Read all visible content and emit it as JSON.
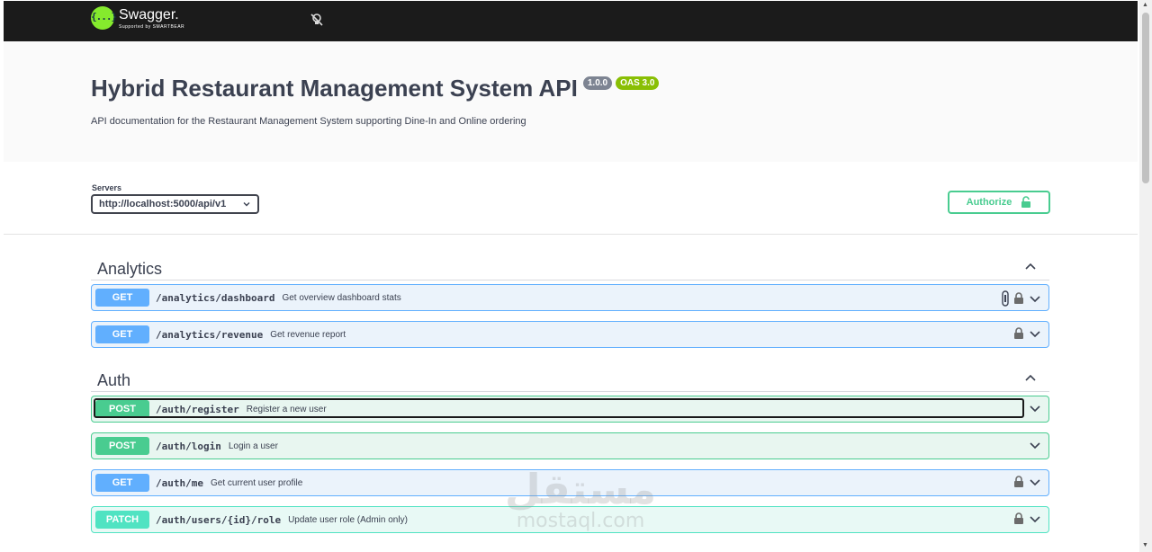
{
  "topbar": {
    "logo_name": "Swagger.",
    "logo_sub": "Supported by SMARTBEAR",
    "logo_mark": "{...}"
  },
  "info": {
    "title": "Hybrid Restaurant Management System API",
    "version_badge": "1.0.0",
    "oas_badge": "OAS 3.0",
    "description": "API documentation for the Restaurant Management System supporting Dine-In and Online ordering"
  },
  "servers": {
    "label": "Servers",
    "selected": "http://localhost:5000/api/v1"
  },
  "authorize": {
    "label": "Authorize"
  },
  "tags": [
    {
      "name": "Analytics",
      "operations": [
        {
          "method": "GET",
          "path": "/analytics/dashboard",
          "summary": "Get overview dashboard stats",
          "locked": true
        },
        {
          "method": "GET",
          "path": "/analytics/revenue",
          "summary": "Get revenue report",
          "locked": true
        }
      ]
    },
    {
      "name": "Auth",
      "operations": [
        {
          "method": "POST",
          "path": "/auth/register",
          "summary": "Register a new user",
          "locked": false
        },
        {
          "method": "POST",
          "path": "/auth/login",
          "summary": "Login a user",
          "locked": false
        },
        {
          "method": "GET",
          "path": "/auth/me",
          "summary": "Get current user profile",
          "locked": true
        },
        {
          "method": "PATCH",
          "path": "/auth/users/{id}/role",
          "summary": "Update user role (Admin only)",
          "locked": true
        }
      ]
    }
  ],
  "watermark": {
    "arabic": "مستقل",
    "latin": "mostaql.com"
  },
  "colors": {
    "get": "#61affe",
    "post": "#49cc90",
    "patch": "#50e3c2",
    "topbar": "#1b1b1b",
    "logo": "#85ea2d",
    "version_badge": "#7d8492",
    "oas_badge": "#89bf04"
  }
}
